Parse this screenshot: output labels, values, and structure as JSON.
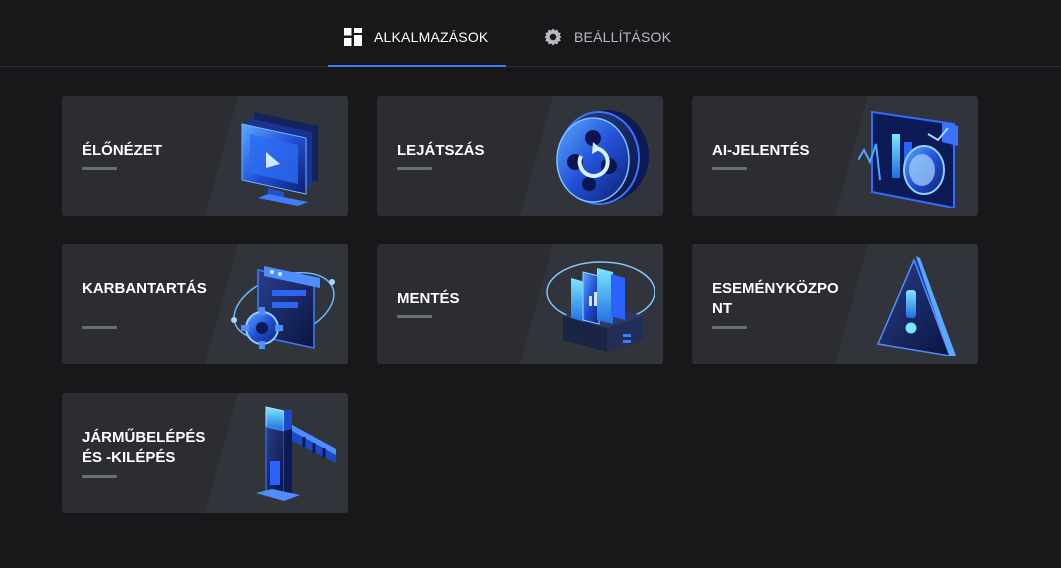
{
  "tabs": {
    "apps": {
      "label": "ALKALMAZÁSOK",
      "icon": "grid-icon",
      "active": true
    },
    "settings": {
      "label": "BEÁLLÍTÁSOK",
      "icon": "gear-icon",
      "active": false
    }
  },
  "cards": [
    {
      "label": "ÉLŐNÉZET",
      "icon": "monitor-icon"
    },
    {
      "label": "LEJÁTSZÁS",
      "icon": "playback-reel-icon"
    },
    {
      "label": "AI-JELENTÉS",
      "icon": "ai-report-chart-icon"
    },
    {
      "label": "KARBANTARTÁS",
      "icon": "maintenance-gear-icon"
    },
    {
      "label": "MENTÉS",
      "icon": "backup-storage-icon"
    },
    {
      "label": "ESEMÉNYKÖZPONT",
      "icon": "warning-triangle-icon"
    },
    {
      "label": "JÁRMŰBELÉPÉS ÉS -KILÉPÉS",
      "icon": "barrier-gate-icon"
    }
  ],
  "colors": {
    "background": "#18181a",
    "card": "#2b2d33",
    "accent": "#3d7bff"
  }
}
